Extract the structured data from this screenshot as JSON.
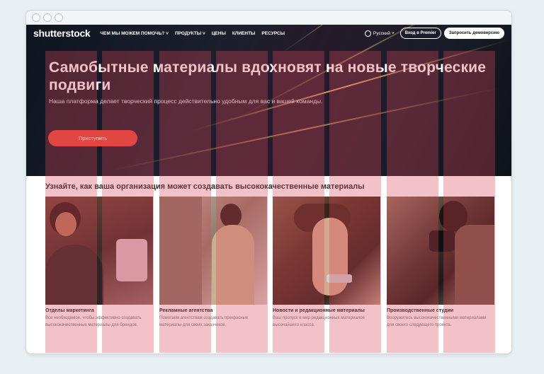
{
  "browser": {
    "dots": [
      "close",
      "minimize",
      "maximize"
    ]
  },
  "nav": {
    "logo": "shutterstock",
    "items": [
      "ЧЕМ МЫ МОЖЕМ ПОМОЧЬ? ˅",
      "ПРОДУКТЫ ˅",
      "ЦЕНЫ",
      "КЛИЕНТЫ",
      "РЕСУРСЫ"
    ],
    "language": "Русский ˅",
    "premier_login": "Вход в Premier",
    "demo_button": "Запросить демоверсию"
  },
  "hero": {
    "title": "Самобытные материалы вдохновят на новые творческие подвиги",
    "subtitle": "Наша платформа делает творческий процесс действительно удобным для вас и вашей команды.",
    "cta": "Приступить"
  },
  "section": {
    "title": "Узнайте, как ваша организация может создавать высококачественные материалы",
    "cards": [
      {
        "title": "Отделы маркетинга",
        "desc": "Все необходимое, чтобы эффективно создавать высококачественные материалы для брендов."
      },
      {
        "title": "Рекламные агентства",
        "desc": "Помогаем агентствам создавать прекрасные материалы для своих заказчиков."
      },
      {
        "title": "Новости и редакционные материалы",
        "desc": "Ваш пропуск в мир редакционных материалов высочайшего класса."
      },
      {
        "title": "Производственные студии",
        "desc": "Вооружитесь высококачественными материалами для своего следующего проекта."
      }
    ]
  },
  "colors": {
    "accent": "#e4463a",
    "hero_bg": "#151a26",
    "overlay": "#dc4658"
  }
}
